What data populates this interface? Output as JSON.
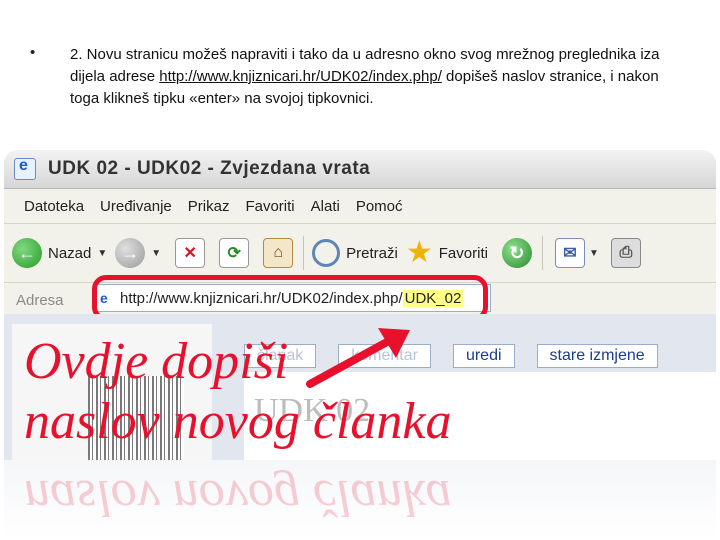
{
  "slide": {
    "bullet": "•",
    "para_before_link": "2. Novu stranicu možeš napraviti i tako da u adresno okno svog mrežnog preglednika iza dijela adrese ",
    "link": "http://www.knjiznicari.hr/UDK02/index.php/",
    "para_after_link": " dopišeš naslov stranice, i nakon toga klikneš tipku «enter» na svojoj tipkovnici."
  },
  "browser": {
    "title": "UDK 02 - UDK02 - Zvjezdana vrata",
    "menu": [
      "Datoteka",
      "Uređivanje",
      "Prikaz",
      "Favoriti",
      "Alati",
      "Pomoć"
    ],
    "toolbar": {
      "back_label": "Nazad",
      "search_label": "Pretraži",
      "favorites_label": "Favoriti"
    },
    "address": {
      "label": "Adresa",
      "url_base": "http://www.knjiznicari.hr/UDK02/index.php/",
      "url_added": "UDK_02"
    }
  },
  "page": {
    "tabs": [
      "članak",
      "komentar",
      "uredi",
      "stare izmjene"
    ],
    "heading": "UDK 02"
  },
  "overlay": {
    "line1": "Ovdje dopiši",
    "line2": "naslov novog članka"
  },
  "colors": {
    "annotation_red": "#e8112d",
    "highlight_yellow": "#ffff88",
    "link_blue": "#1a3c8c"
  }
}
